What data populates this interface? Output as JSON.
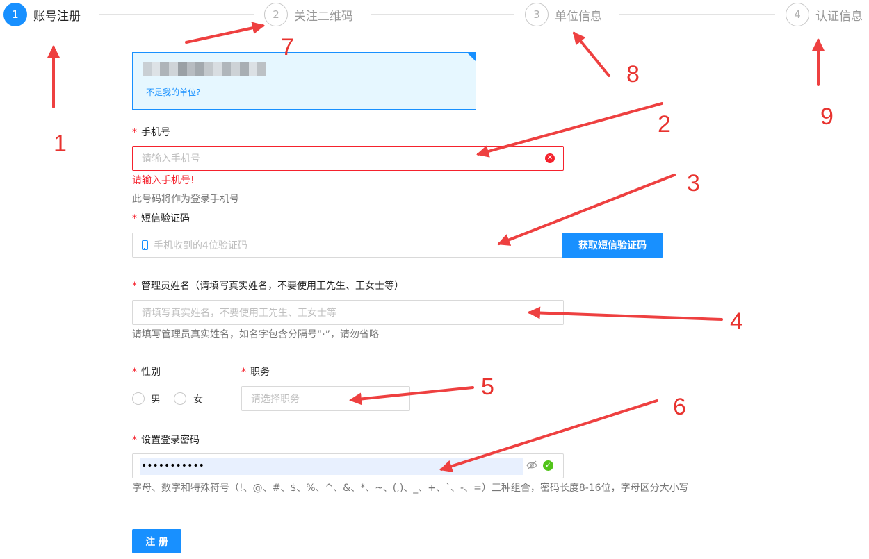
{
  "steps": [
    {
      "number": "1",
      "title": "账号注册",
      "active": true
    },
    {
      "number": "2",
      "title": "关注二维码",
      "active": false
    },
    {
      "number": "3",
      "title": "单位信息",
      "active": false
    },
    {
      "number": "4",
      "title": "认证信息",
      "active": false
    }
  ],
  "unit_box": {
    "link_text": "不是我的单位?"
  },
  "phone": {
    "label": "手机号",
    "required_mark": "*",
    "placeholder": "请输入手机号",
    "error": "请输入手机号!",
    "hint": "此号码将作为登录手机号"
  },
  "sms": {
    "label": "短信验证码",
    "required_mark": "*",
    "placeholder": "手机收到的4位验证码",
    "button": "获取短信验证码"
  },
  "admin_name": {
    "label": "管理员姓名（请填写真实姓名，不要使用王先生、王女士等）",
    "required_mark": "*",
    "placeholder": "请填写真实姓名，不要使用王先生、王女士等",
    "hint": "请填写管理员真实姓名，如名字包含分隔号“·”，请勿省略"
  },
  "gender": {
    "label": "性别",
    "required_mark": "*",
    "options": [
      "男",
      "女"
    ]
  },
  "position": {
    "label": "职务",
    "required_mark": "*",
    "placeholder": "请选择职务"
  },
  "password": {
    "label": "设置登录密码",
    "required_mark": "*",
    "value": "•••••••••••",
    "hint": "字母、数字和特殊符号（!、@、#、$、%、^、&、*、~、(,)、_、+、`、-、=）三种组合，密码长度8-16位，字母区分大小写"
  },
  "submit": {
    "label": "注 册"
  },
  "annotations": [
    "1",
    "2",
    "3",
    "4",
    "5",
    "6",
    "7",
    "8",
    "9"
  ],
  "colors": {
    "primary": "#1890ff",
    "error": "#f5222d",
    "annotation": "#e8332f",
    "success": "#52c41a"
  },
  "icons": [
    "clear-icon",
    "phone-icon",
    "eye-off-icon",
    "check-circle-icon"
  ]
}
